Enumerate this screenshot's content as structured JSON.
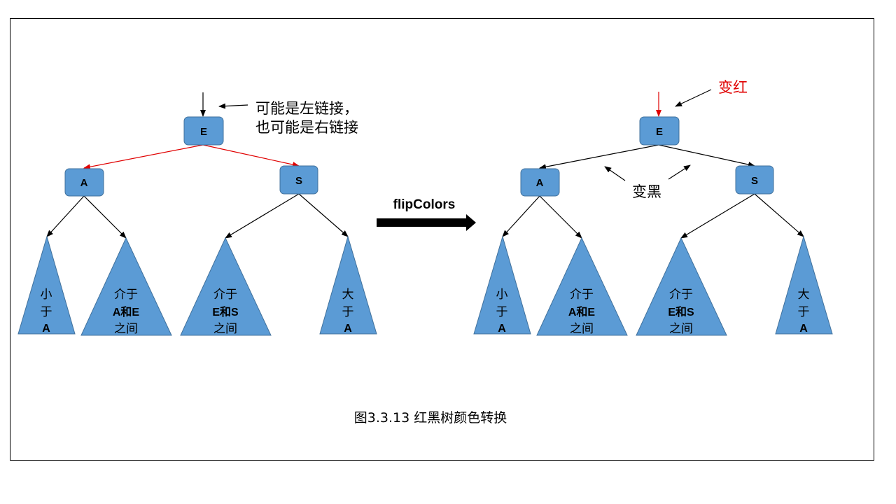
{
  "left_tree": {
    "root": "E",
    "left": "A",
    "right": "S",
    "note_line1": "可能是左链接，",
    "note_line2": "也可能是右链接",
    "subtrees": [
      [
        "小",
        "于",
        "A"
      ],
      [
        "介于",
        "A和E",
        "之间"
      ],
      [
        "介于",
        "E和S",
        "之间"
      ],
      [
        "大",
        "于",
        "A"
      ]
    ],
    "link_color": "#e00000"
  },
  "operation": "flipColors",
  "right_tree": {
    "root": "E",
    "left": "A",
    "right": "S",
    "note_red": "变红",
    "note_black": "变黑",
    "subtrees": [
      [
        "小",
        "于",
        "A"
      ],
      [
        "介于",
        "A和E",
        "之间"
      ],
      [
        "介于",
        "E和S",
        "之间"
      ],
      [
        "大",
        "于",
        "A"
      ]
    ],
    "link_color": "#000000"
  },
  "caption": "图3.3.13 红黑树颜色转换",
  "colors": {
    "node_fill": "#5b9bd5",
    "red": "#e00000",
    "black": "#000000"
  }
}
